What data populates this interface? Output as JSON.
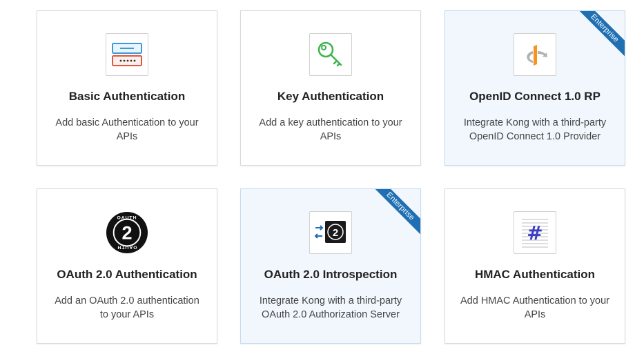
{
  "colors": {
    "ribbon": "#1f6fb2",
    "enterprise_card_bg": "#f1f7fd",
    "card_border": "#d9d9d9"
  },
  "cards": [
    {
      "title": "Basic Authentication",
      "description": "Add basic Authentication to your APIs",
      "icon": "basic-auth-form-icon",
      "enterprise": false
    },
    {
      "title": "Key Authentication",
      "description": "Add a key authentication to your APIs",
      "icon": "key-icon",
      "enterprise": false
    },
    {
      "title": "OpenID Connect 1.0 RP",
      "description": "Integrate Kong with a third-party OpenID Connect 1.0 Provider",
      "icon": "openid-icon",
      "enterprise": true,
      "ribbon": "Enterprise"
    },
    {
      "title": "OAuth 2.0 Authentication",
      "description": "Add an OAuth 2.0 authentication to your APIs",
      "icon": "oauth2-badge-icon",
      "badge_text": "OAUTH",
      "badge_number": "2",
      "enterprise": false
    },
    {
      "title": "OAuth 2.0 Introspection",
      "description": "Integrate Kong with a third-party OAuth 2.0 Authorization Server",
      "icon": "oauth2-introspection-icon",
      "badge_number": "2",
      "enterprise": true,
      "ribbon": "Enterprise"
    },
    {
      "title": "HMAC Authentication",
      "description": "Add HMAC Authentication to your APIs",
      "icon": "hash-document-icon",
      "symbol": "#",
      "enterprise": false
    }
  ]
}
